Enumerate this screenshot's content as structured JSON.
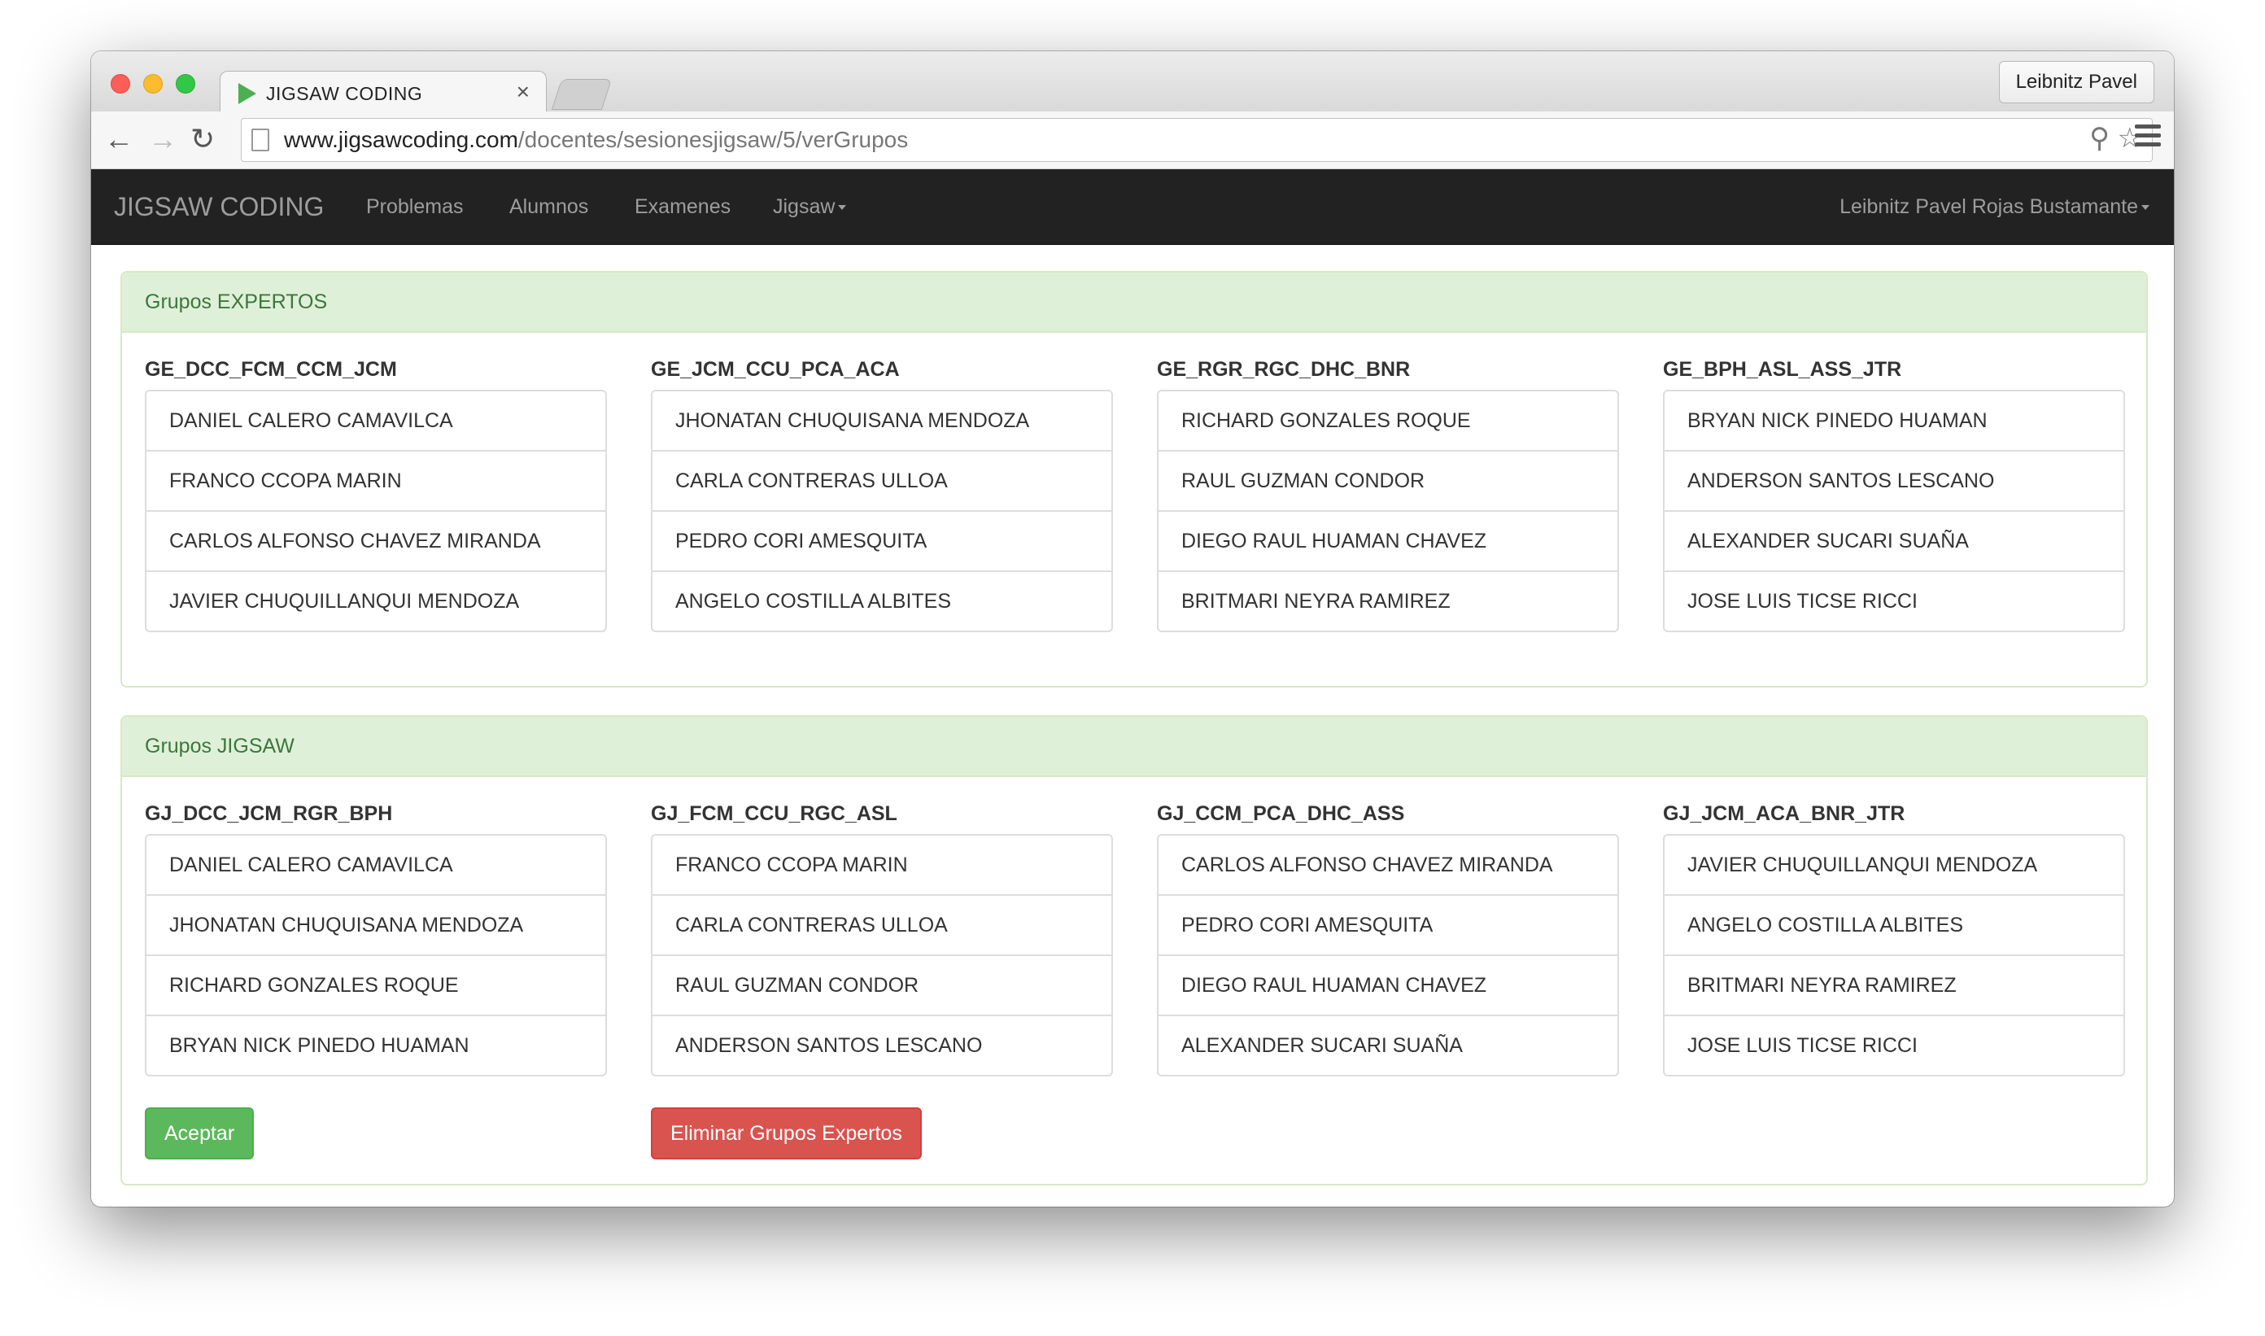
{
  "browser": {
    "tab_title": "JIGSAW CODING",
    "tab_close": "×",
    "profile": "Leibnitz Pavel",
    "url_host": "www.jigsawcoding.com",
    "url_path": "/docentes/sesionesjigsaw/5/verGrupos"
  },
  "navbar": {
    "brand": "JIGSAW CODING",
    "items": [
      "Problemas",
      "Alumnos",
      "Examenes",
      "Jigsaw"
    ],
    "user": "Leibnitz Pavel Rojas Bustamante"
  },
  "expertos": {
    "title": "Grupos EXPERTOS",
    "groups": [
      {
        "name": "GE_DCC_FCM_CCM_JCM",
        "members": [
          "DANIEL CALERO CAMAVILCA",
          "FRANCO CCOPA MARIN",
          "CARLOS ALFONSO CHAVEZ MIRANDA",
          "JAVIER CHUQUILLANQUI MENDOZA"
        ]
      },
      {
        "name": "GE_JCM_CCU_PCA_ACA",
        "members": [
          "JHONATAN CHUQUISANA MENDOZA",
          "CARLA CONTRERAS ULLOA",
          "PEDRO CORI AMESQUITA",
          "ANGELO COSTILLA ALBITES"
        ]
      },
      {
        "name": "GE_RGR_RGC_DHC_BNR",
        "members": [
          "RICHARD GONZALES ROQUE",
          "RAUL GUZMAN CONDOR",
          "DIEGO RAUL HUAMAN CHAVEZ",
          "BRITMARI NEYRA RAMIREZ"
        ]
      },
      {
        "name": "GE_BPH_ASL_ASS_JTR",
        "members": [
          "BRYAN NICK PINEDO HUAMAN",
          "ANDERSON SANTOS LESCANO",
          "ALEXANDER SUCARI SUAÑA",
          "JOSE LUIS TICSE RICCI"
        ]
      }
    ]
  },
  "jigsaw": {
    "title": "Grupos JIGSAW",
    "groups": [
      {
        "name": "GJ_DCC_JCM_RGR_BPH",
        "members": [
          "DANIEL CALERO CAMAVILCA",
          "JHONATAN CHUQUISANA MENDOZA",
          "RICHARD GONZALES ROQUE",
          "BRYAN NICK PINEDO HUAMAN"
        ]
      },
      {
        "name": "GJ_FCM_CCU_RGC_ASL",
        "members": [
          "FRANCO CCOPA MARIN",
          "CARLA CONTRERAS ULLOA",
          "RAUL GUZMAN CONDOR",
          "ANDERSON SANTOS LESCANO"
        ]
      },
      {
        "name": "GJ_CCM_PCA_DHC_ASS",
        "members": [
          "CARLOS ALFONSO CHAVEZ MIRANDA",
          "PEDRO CORI AMESQUITA",
          "DIEGO RAUL HUAMAN CHAVEZ",
          "ALEXANDER SUCARI SUAÑA"
        ]
      },
      {
        "name": "GJ_JCM_ACA_BNR_JTR",
        "members": [
          "JAVIER CHUQUILLANQUI MENDOZA",
          "ANGELO COSTILLA ALBITES",
          "BRITMARI NEYRA RAMIREZ",
          "JOSE LUIS TICSE RICCI"
        ]
      }
    ]
  },
  "actions": {
    "accept": "Aceptar",
    "delete": "Eliminar Grupos Expertos"
  }
}
